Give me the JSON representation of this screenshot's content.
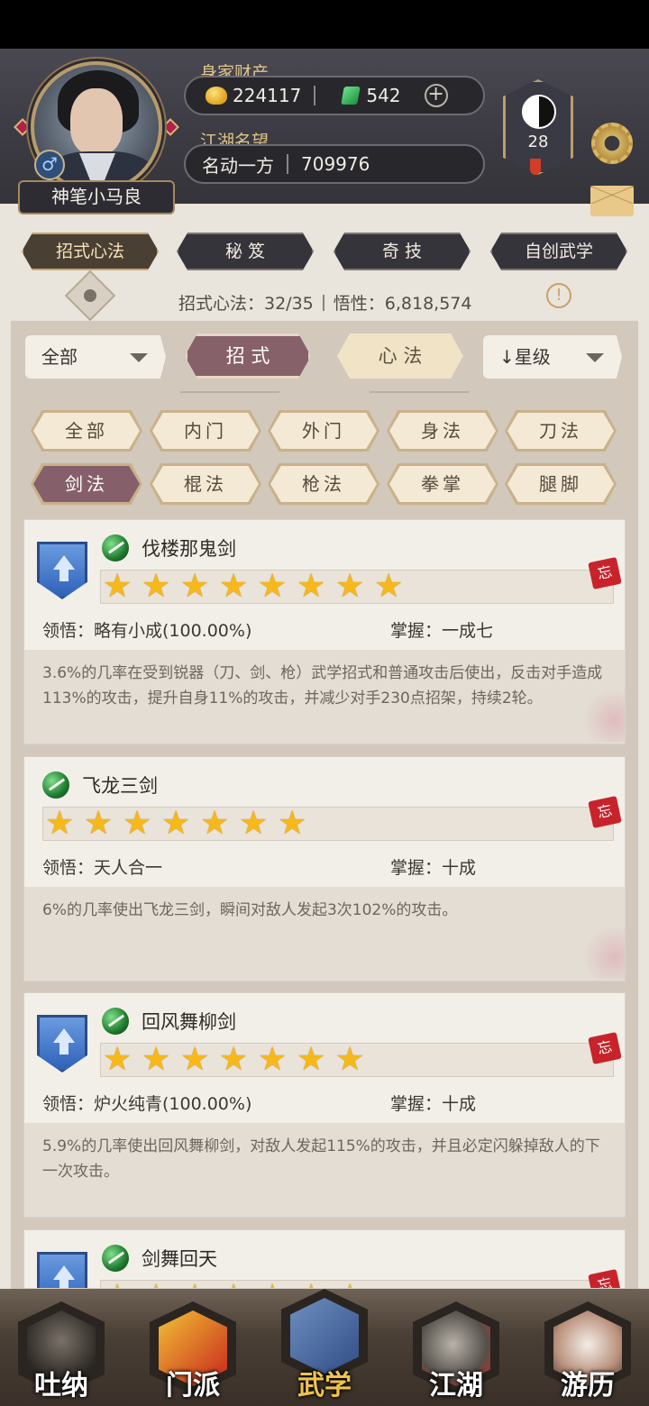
{
  "header": {
    "player_name": "神笔小马良",
    "gender_symbol": "♂",
    "wealth_label": "身家财产",
    "gold": "224117",
    "jade": "542",
    "add_symbol": "+",
    "reputation_label": "江湖名望",
    "reputation_title": "名动一方",
    "reputation_value": "709976",
    "level": "28"
  },
  "top_tabs": [
    {
      "label": "招式心法",
      "active": true
    },
    {
      "label": "秘 笈",
      "active": false
    },
    {
      "label": "奇 技",
      "active": false
    },
    {
      "label": "自创武学",
      "active": false
    }
  ],
  "stats": {
    "skills_text": "招式心法：32/35",
    "insight_text": "悟性：6,818,574",
    "info_symbol": "!"
  },
  "filters": {
    "scope_dropdown": "全部",
    "seg_left": "招 式",
    "seg_right": "心 法",
    "sort_dropdown": "↓星级"
  },
  "categories": [
    {
      "label": "全部",
      "active": false
    },
    {
      "label": "内门",
      "active": false
    },
    {
      "label": "外门",
      "active": false
    },
    {
      "label": "身法",
      "active": false
    },
    {
      "label": "刀法",
      "active": false
    },
    {
      "label": "剑法",
      "active": true
    },
    {
      "label": "棍法",
      "active": false
    },
    {
      "label": "枪法",
      "active": false
    },
    {
      "label": "拳掌",
      "active": false
    },
    {
      "label": "腿脚",
      "active": false
    }
  ],
  "skills": [
    {
      "name": "伐楼那鬼剑",
      "stars": 8,
      "has_upgrade": true,
      "insight": "领悟：略有小成(100.00%)",
      "mastery": "掌握：一成七",
      "description": "3.6%的几率在受到锐器（刀、剑、枪）武学招式和普通攻击后使出，反击对手造成113%的攻击，提升自身11%的攻击，并减少对手230点招架，持续2轮。",
      "forget_label": "忘"
    },
    {
      "name": "飞龙三剑",
      "stars": 7,
      "has_upgrade": false,
      "insight": "领悟：天人合一",
      "mastery": "掌握：十成",
      "description": "6%的几率使出飞龙三剑，瞬间对敌人发起3次102%的攻击。",
      "forget_label": "忘"
    },
    {
      "name": "回风舞柳剑",
      "stars": 7,
      "has_upgrade": true,
      "insight": "领悟：炉火纯青(100.00%)",
      "mastery": "掌握：十成",
      "description": "5.9%的几率使出回风舞柳剑，对敌人发起115%的攻击，并且必定闪躲掉敌人的下一次攻击。",
      "forget_label": "忘"
    },
    {
      "name": "剑舞回天",
      "stars": 7,
      "has_upgrade": true,
      "forget_label": "忘"
    }
  ],
  "bottom_nav": [
    {
      "label": "吐纳",
      "active": false
    },
    {
      "label": "门派",
      "active": false
    },
    {
      "label": "武学",
      "active": true
    },
    {
      "label": "江湖",
      "active": false
    },
    {
      "label": "游历",
      "active": false
    }
  ],
  "icons": {
    "gold": "gold-ingot-icon",
    "jade": "jade-icon",
    "level": "taiji-icon",
    "settings": "gear-icon",
    "mail": "mail-icon",
    "view": "eye-icon",
    "info": "info-icon",
    "upgrade": "upgrade-arrow-icon",
    "skill_type": "sword-leaf-icon",
    "star": "star-icon",
    "forget": "forget-stamp-icon"
  },
  "colors": {
    "header_bg": "#3b3a42",
    "accent_gold": "#e0c588",
    "active_tab": "#87616a",
    "star": "#f6b81b",
    "forget_red": "#c8232b"
  }
}
